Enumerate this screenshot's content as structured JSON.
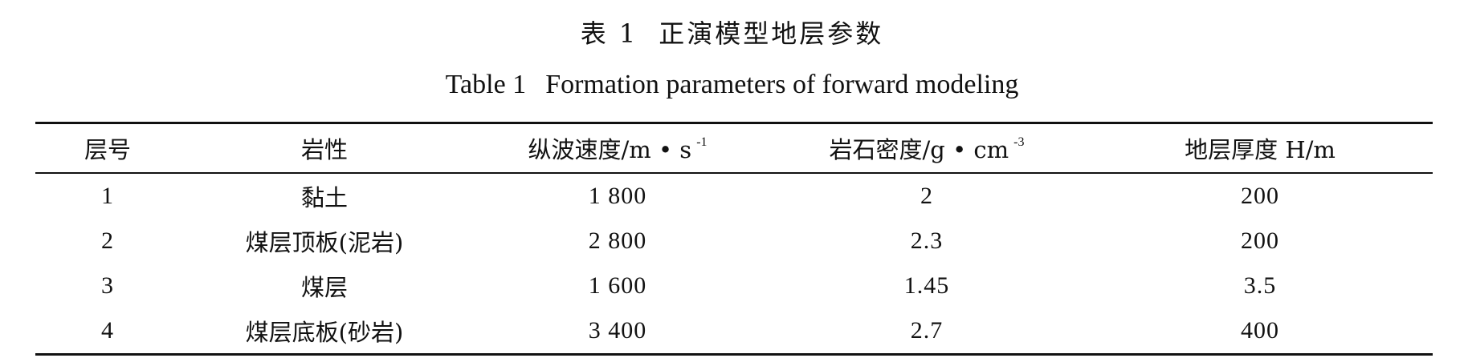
{
  "title": {
    "cn_label": "表 1",
    "cn_text": "正演模型地层参数",
    "en_label": "Table 1",
    "en_text": "Formation parameters of forward modeling"
  },
  "table": {
    "headers": [
      {
        "label": "层号"
      },
      {
        "label": "岩性"
      },
      {
        "label": "纵波速度/m • s",
        "sup": "-1"
      },
      {
        "label": "岩石密度/g • cm",
        "sup": "-3"
      },
      {
        "label": "地层厚度 H/m"
      }
    ],
    "rows": [
      [
        "1",
        "黏土",
        "1 800",
        "2",
        "200"
      ],
      [
        "2",
        "煤层顶板(泥岩)",
        "2 800",
        "2.3",
        "200"
      ],
      [
        "3",
        "煤层",
        "1 600",
        "1.45",
        "3.5"
      ],
      [
        "4",
        "煤层底板(砂岩)",
        "3 400",
        "2.7",
        "400"
      ]
    ]
  }
}
